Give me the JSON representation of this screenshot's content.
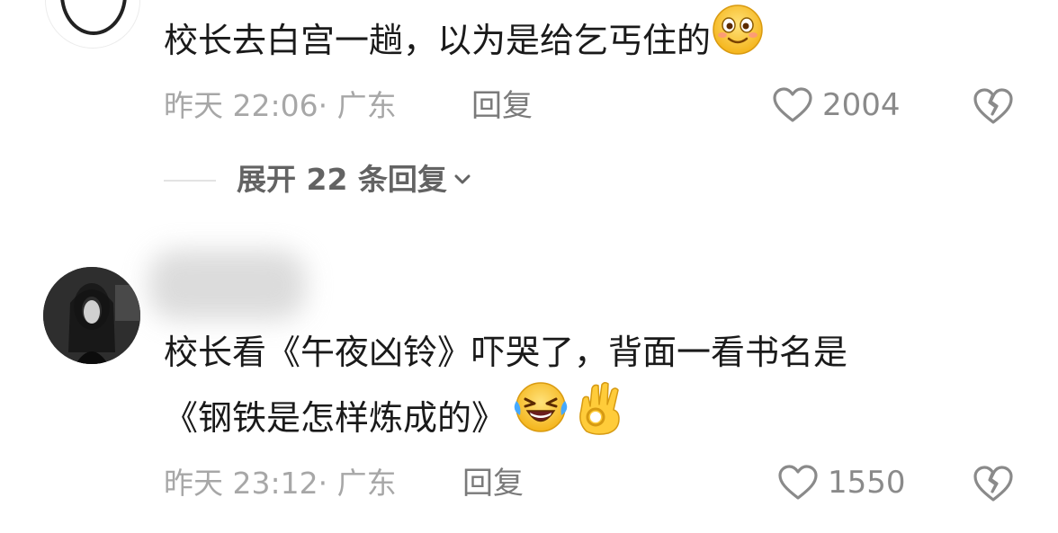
{
  "comments": [
    {
      "text": "校长去白宫一趟，以为是给乞丐住的",
      "emojis": [
        "smiling-face-emoji"
      ],
      "time": "昨天 22:06",
      "location": "· 广东",
      "reply_label": "回复",
      "likes": "2004",
      "expand_replies_label": "展开 22 条回复"
    },
    {
      "text_line1": "校长看《午夜凶铃》吓哭了，背面一看书名是",
      "text_line2": "《钢铁是怎样炼成的》",
      "emojis": [
        "rolling-laughing-emoji",
        "ok-hand-emoji"
      ],
      "time": "昨天 23:12",
      "location": "· 广东",
      "reply_label": "回复",
      "likes": "1550"
    }
  ],
  "colors": {
    "text_primary": "#1a1a1a",
    "text_meta": "#a7a7a7",
    "text_action": "#7a7a7a",
    "expand_text": "#636363",
    "emoji_yellow": "#f7c531"
  },
  "icons": [
    "heart-outline-icon",
    "broken-heart-icon",
    "chevron-down-icon"
  ]
}
